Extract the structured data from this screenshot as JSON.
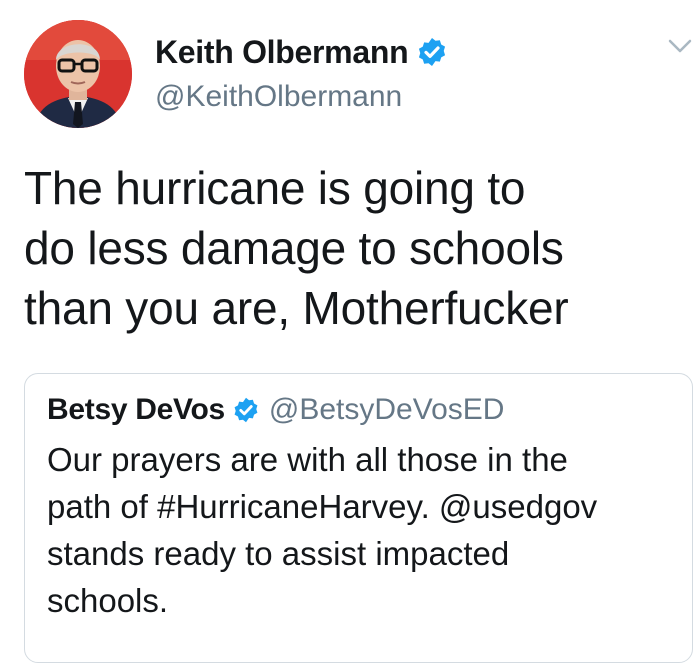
{
  "tweet": {
    "author": {
      "display_name": "Keith Olbermann",
      "handle": "@KeithOlbermann",
      "verified": true,
      "avatar_icon": "profile-photo"
    },
    "text": "The hurricane is going to\ndo less damage to schools\nthan you are, Motherfucker",
    "menu_icon": "chevron-down-icon"
  },
  "quoted_tweet": {
    "author": {
      "display_name": "Betsy DeVos",
      "handle": "@BetsyDeVosED",
      "verified": true
    },
    "text": "Our prayers are with all those in the\npath of #HurricaneHarvey. @usedgov\nstands ready to assist impacted\nschools."
  },
  "colors": {
    "text_primary": "#14171a",
    "text_secondary": "#657786",
    "verified_badge": "#1da1f2",
    "quote_border": "#d4dbe1"
  }
}
